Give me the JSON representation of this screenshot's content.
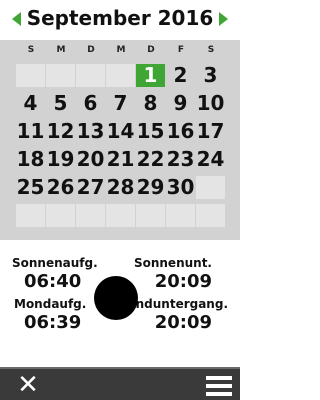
{
  "header": {
    "month_title": "September 2016",
    "prev_icon": "chevron-left-icon",
    "next_icon": "chevron-right-icon",
    "accent_color": "#3fa535"
  },
  "calendar": {
    "weekdays": [
      "S",
      "M",
      "D",
      "M",
      "D",
      "F",
      "S"
    ],
    "weeks": [
      [
        "",
        "",
        "",
        "",
        "1",
        "2",
        "3"
      ],
      [
        "4",
        "5",
        "6",
        "7",
        "8",
        "9",
        "10"
      ],
      [
        "11",
        "12",
        "13",
        "14",
        "15",
        "16",
        "17"
      ],
      [
        "18",
        "19",
        "20",
        "21",
        "22",
        "23",
        "24"
      ],
      [
        "25",
        "26",
        "27",
        "28",
        "29",
        "30",
        ""
      ],
      [
        "",
        "",
        "",
        "",
        "",
        "",
        ""
      ]
    ],
    "today": "1"
  },
  "info": {
    "sunrise_label": "Sonnenaufg.",
    "sunrise_time": "06:40",
    "sunset_label": "Sonnenunt.",
    "sunset_time": "20:09",
    "moonrise_label": "Mondaufg.",
    "moonrise_time": "06:39",
    "moonset_label": "Monduntergang.",
    "moonset_time": "20:09",
    "moon_icon": "new-moon-icon"
  },
  "bottom_bar": {
    "close_icon": "close-icon",
    "menu_icon": "menu-icon"
  }
}
